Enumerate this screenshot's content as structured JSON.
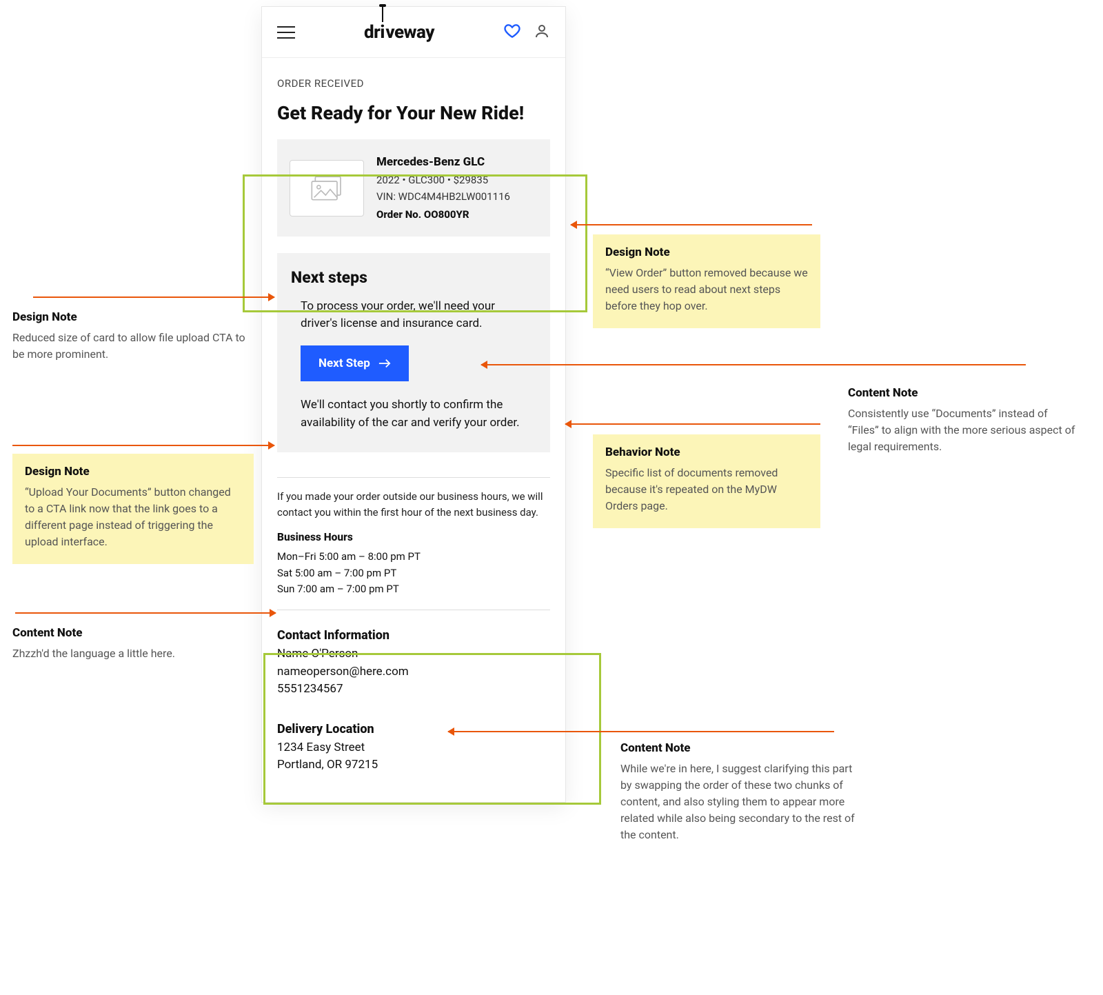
{
  "header": {
    "logo_pre": "dr",
    "logo_post": "veway"
  },
  "page": {
    "eyebrow": "ORDER RECEIVED",
    "title": "Get Ready for Your New Ride!"
  },
  "vehicle": {
    "name": "Mercedes-Benz GLC",
    "meta": "2022  •  GLC300  •  $29835",
    "vin": "VIN: WDC4M4HB2LW001116",
    "order": "Order No. OO800YR"
  },
  "next": {
    "heading": "Next steps",
    "intro": "To process your order, we'll need your driver's license and insurance card.",
    "button": "Next Step",
    "followup": "We'll contact you shortly to confirm the availability of the car and verify your order."
  },
  "business": {
    "note": "If you made your order outside our business hours, we will contact you within the first hour of the next business day.",
    "heading": "Business Hours",
    "line1": "Mon–Fri 5:00 am – 8:00 pm PT",
    "line2": "Sat 5:00 am – 7:00 pm PT",
    "line3": "Sun 7:00 am – 7:00 pm PT"
  },
  "contact": {
    "heading": "Contact Information",
    "name": "Name O'Person",
    "email": "nameoperson@here.com",
    "phone": "5551234567"
  },
  "delivery": {
    "heading": "Delivery Location",
    "line1": "1234 Easy Street",
    "line2": "Portland, OR 97215"
  },
  "annotations": {
    "a1": {
      "title": "Design Note",
      "body": "Reduced size of card to allow file upload CTA to be more prominent."
    },
    "a2": {
      "title": "Design Note",
      "body": "“Upload Your Documents” button changed to a CTA link now that the link goes to a different page instead of triggering the upload interface."
    },
    "a3": {
      "title": "Content Note",
      "body": "Zhzzh'd the language a little here."
    },
    "a4": {
      "title": "Design Note",
      "body": "“View Order” button removed because we need users to read about next steps before they hop over."
    },
    "a5": {
      "title": "Behavior Note",
      "body": "Specific list of documents removed because it's repeated on the MyDW Orders page."
    },
    "a6": {
      "title": "Content Note",
      "body": "Consistently use “Documents” instead of “Files” to align with the more serious aspect of legal requirements."
    },
    "a7": {
      "title": "Content Note",
      "body": "While we're in here, I suggest clarifying this part by swapping the order of these two chunks of content, and also styling them to appear more related while also being secondary to the rest of the content."
    }
  }
}
